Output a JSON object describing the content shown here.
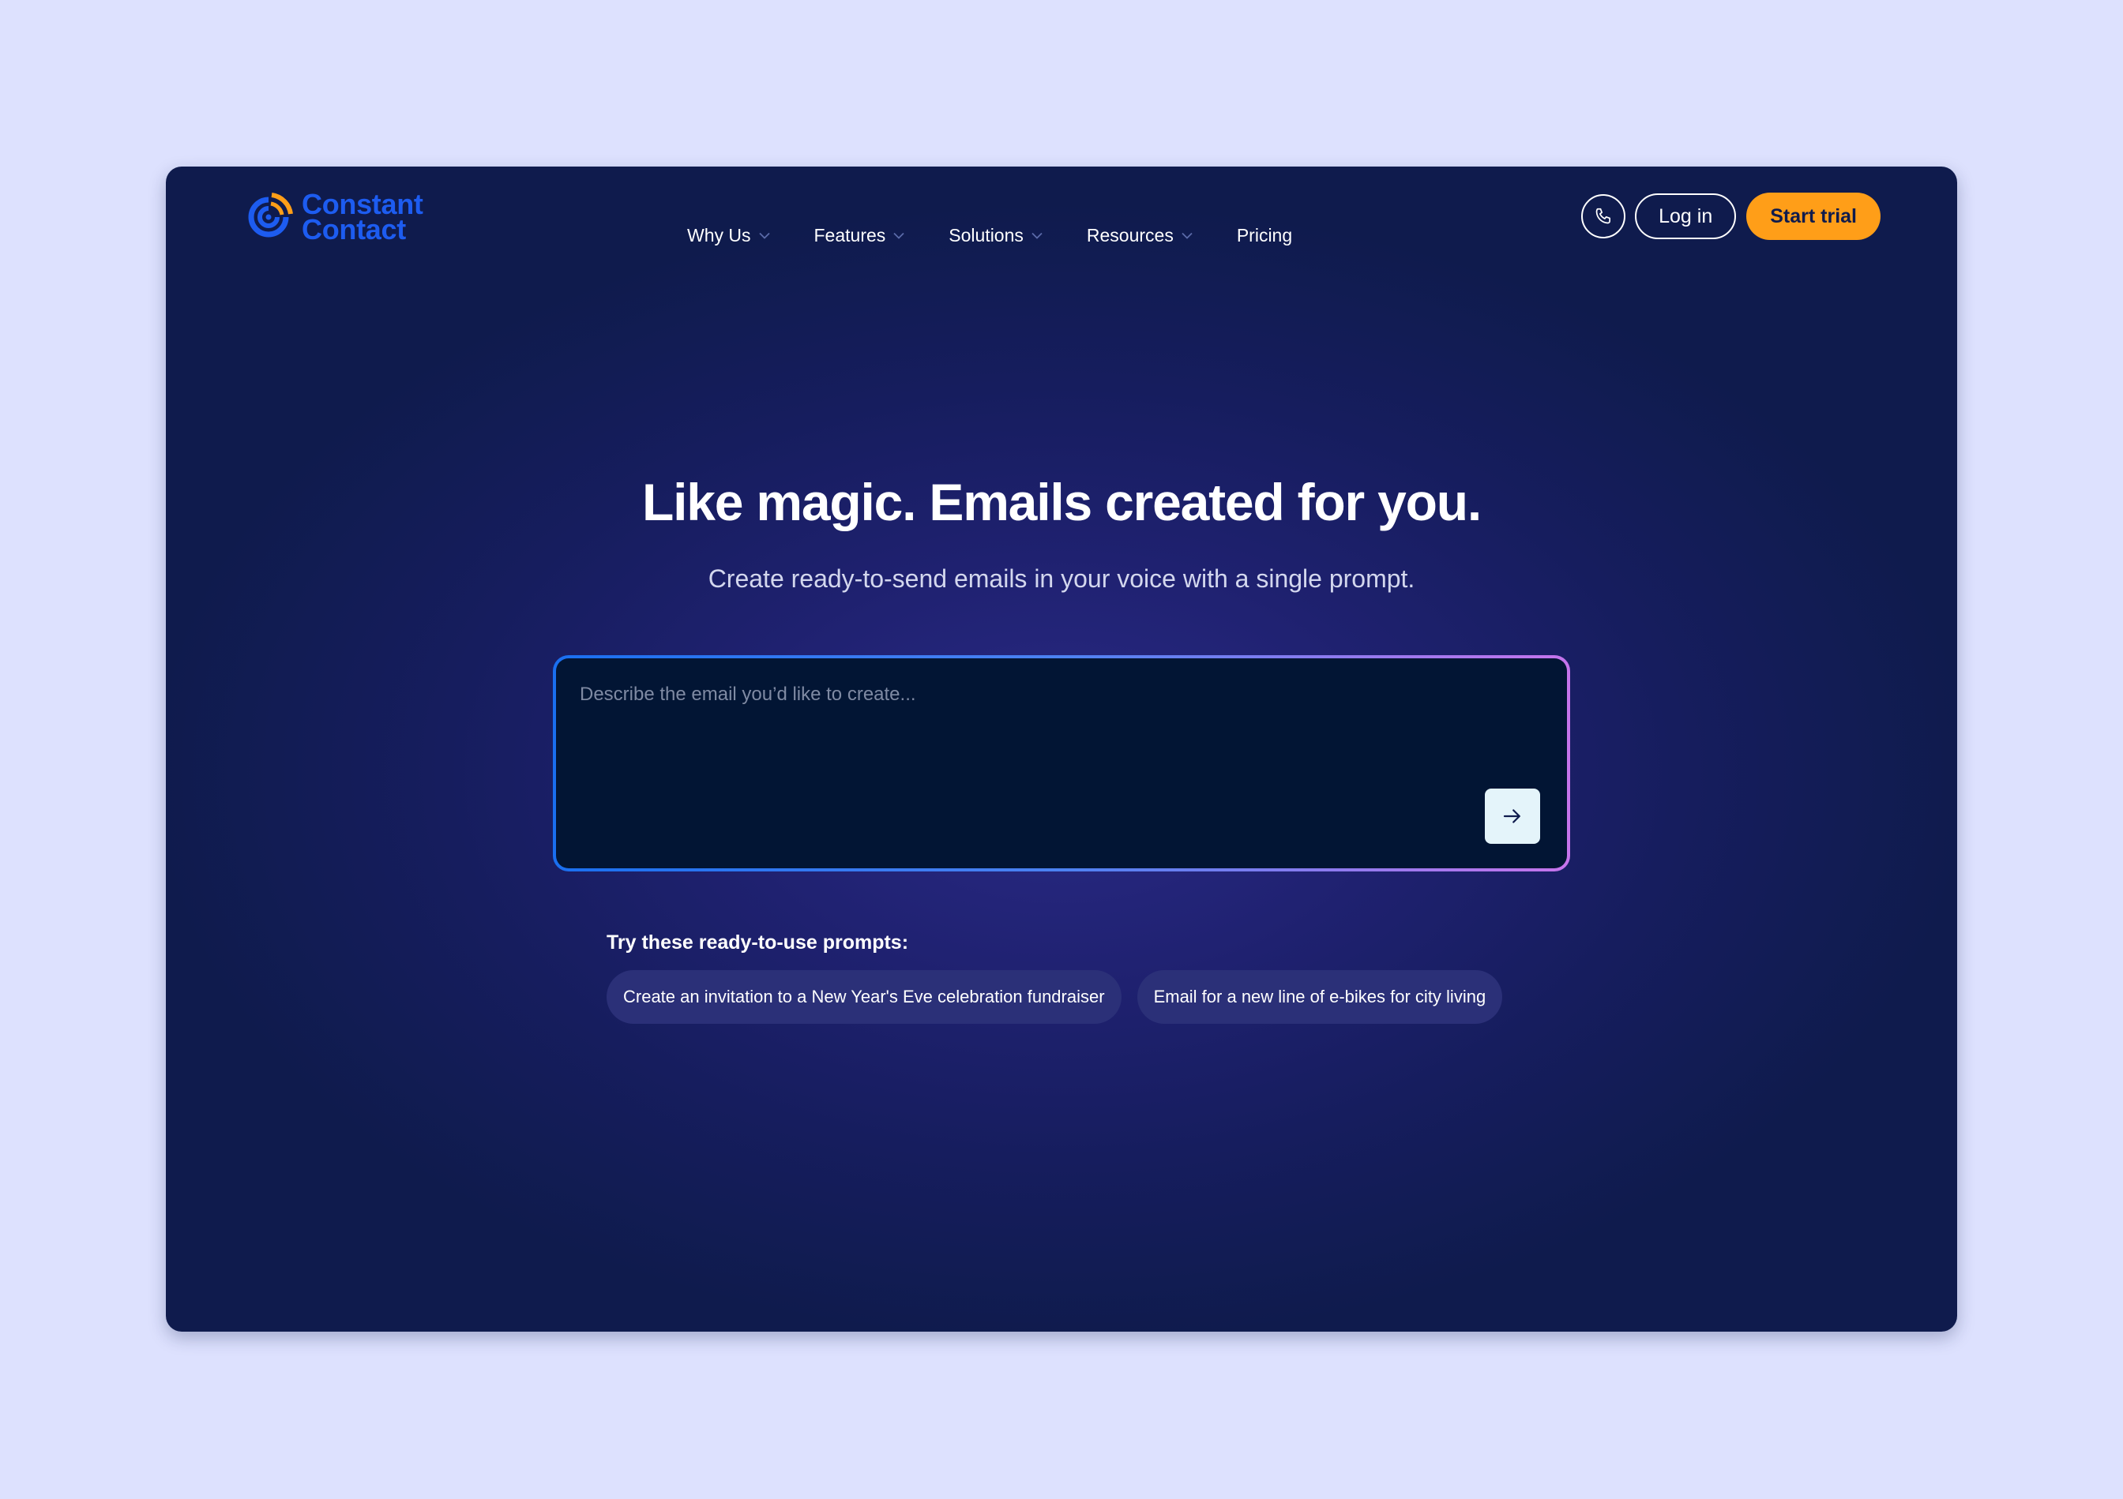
{
  "brand": {
    "line1": "Constant",
    "line2": "Contact",
    "icon": "constant-contact-logo",
    "color": "#1d5cf0",
    "accent": "#ff9e18"
  },
  "nav": {
    "items": [
      {
        "label": "Why Us",
        "has_dropdown": true
      },
      {
        "label": "Features",
        "has_dropdown": true
      },
      {
        "label": "Solutions",
        "has_dropdown": true
      },
      {
        "label": "Resources",
        "has_dropdown": true
      },
      {
        "label": "Pricing",
        "has_dropdown": false
      }
    ]
  },
  "header_actions": {
    "phone_icon": "phone-icon",
    "login_label": "Log in",
    "trial_label": "Start trial",
    "trial_color": "#ff9e18"
  },
  "hero": {
    "headline": "Like magic. Emails created for you.",
    "subheadline": "Create ready-to-send emails in your voice with a single prompt."
  },
  "prompt": {
    "placeholder": "Describe the email you’d like to create...",
    "value": "",
    "submit_icon": "arrow-right-icon",
    "border_gradient": [
      "#1a6ff0",
      "#c674ec"
    ]
  },
  "suggestions": {
    "title": "Try these ready-to-use prompts:",
    "items": [
      "Create an invitation to a New Year's Eve celebration fundraiser",
      "Email for a new line of e-bikes for city living"
    ]
  },
  "colors": {
    "page_background": "#dde1fe",
    "panel_background": "#0f1b4d",
    "input_background": "#021534"
  }
}
